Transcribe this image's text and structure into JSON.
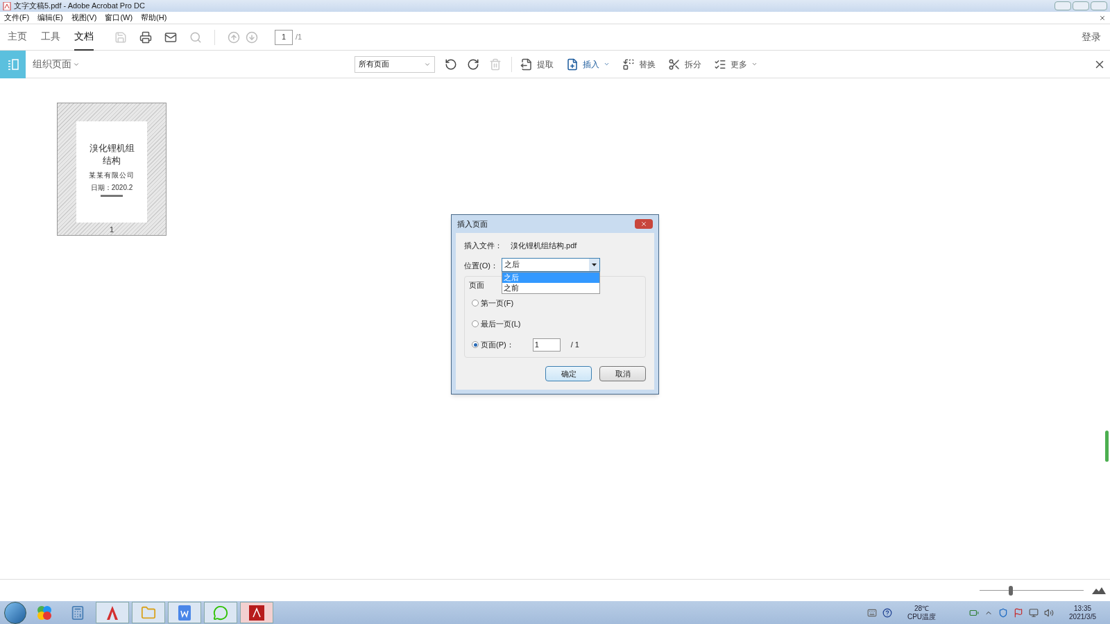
{
  "window": {
    "title": "文字文稿5.pdf - Adobe Acrobat Pro DC"
  },
  "menu": [
    "文件(F)",
    "编辑(E)",
    "视图(V)",
    "窗口(W)",
    "帮助(H)"
  ],
  "nav_tabs": [
    {
      "label": "主页",
      "selected": false
    },
    {
      "label": "工具",
      "selected": false
    },
    {
      "label": "文档",
      "selected": true
    }
  ],
  "page_nav": {
    "current": "1",
    "total": "/1"
  },
  "login": "登录",
  "organize": {
    "title": "组织页面",
    "range": "所有页面",
    "actions": [
      {
        "kind": "extract",
        "label": "提取",
        "selected": false
      },
      {
        "kind": "insert",
        "label": "插入",
        "selected": true
      },
      {
        "kind": "replace",
        "label": "替换",
        "selected": false
      },
      {
        "kind": "split",
        "label": "拆分",
        "selected": false
      },
      {
        "kind": "more",
        "label": "更多",
        "selected": false
      }
    ]
  },
  "thumbnail": {
    "title": "溴化锂机组结构",
    "company": "某某有限公司",
    "date": "日期：2020.2",
    "number": "1"
  },
  "dialog": {
    "title": "插入页面",
    "file_label": "插入文件：",
    "file_name": "溴化锂机组结构.pdf",
    "position_label": "位置(O)：",
    "position_value": "之后",
    "options": [
      {
        "label": "之后",
        "selected": true
      },
      {
        "label": "之前",
        "selected": false
      }
    ],
    "group_label": "页面",
    "radios": [
      {
        "label": "第一页(F)",
        "selected": false
      },
      {
        "label": "最后一页(L)",
        "selected": false
      },
      {
        "label": "页面(P)：",
        "selected": true
      }
    ],
    "page_value": "1",
    "page_total": "/ 1",
    "ok": "确定",
    "cancel": "取消"
  },
  "zoom": {
    "level": 0.3
  },
  "tray": {
    "temp": "28℃",
    "temp_label": "CPU温度",
    "time": "13:35",
    "date": "2021/3/5"
  }
}
